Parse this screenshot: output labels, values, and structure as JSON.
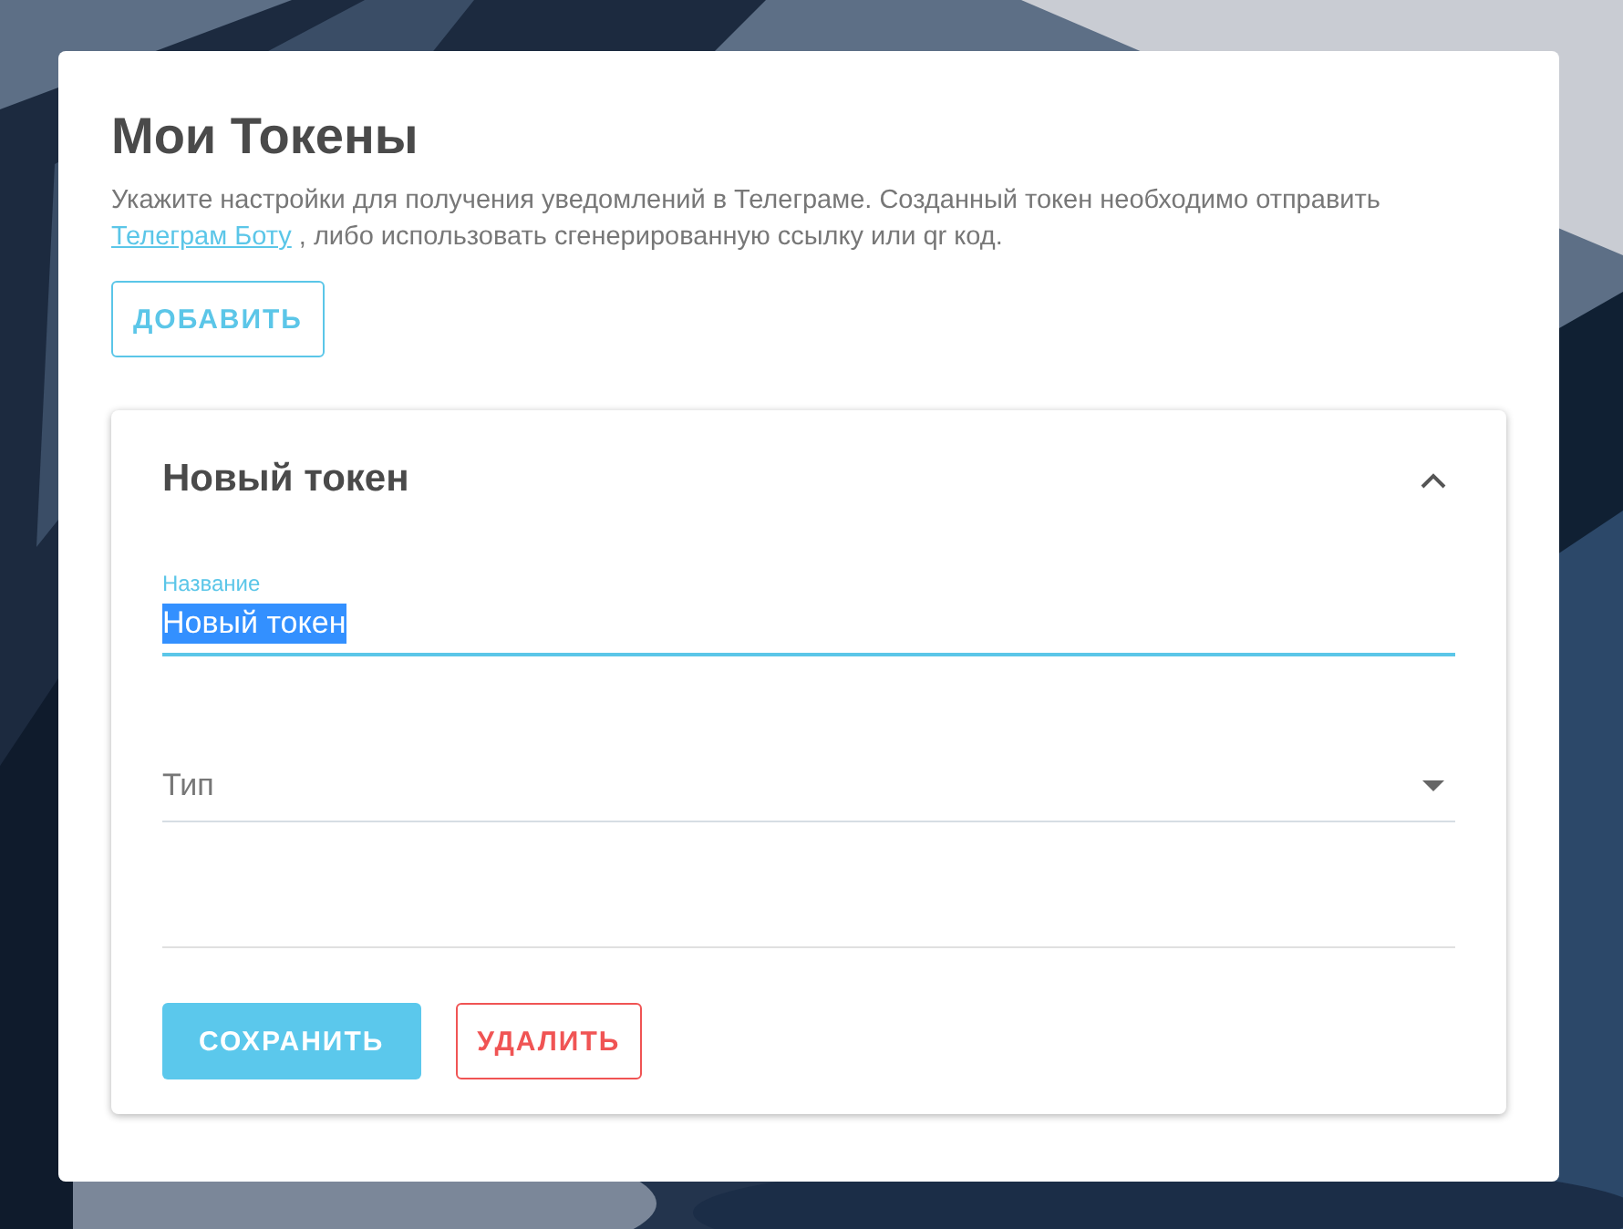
{
  "title": "Мои Токены",
  "description": {
    "before": "Укажите настройки для получения уведомлений в Телеграме. Созданный токен необходимо отправить ",
    "link": "Телеграм Боту",
    "after": " , либо использовать сгенерированную ссылку или qr код."
  },
  "add_button": "ДОБАВИТЬ",
  "tokens": [
    {
      "title": "Новый токен",
      "expanded": true,
      "fields": [
        {
          "kind": "text",
          "label": "Название",
          "value": "Новый токен",
          "focused": true,
          "text_selected": true
        },
        {
          "kind": "select",
          "placeholder": "Тип",
          "focused": false
        }
      ],
      "buttons": [
        {
          "kind": "primary",
          "label": "СОХРАНИТЬ"
        },
        {
          "kind": "danger",
          "label": "УДАЛИТЬ"
        }
      ]
    }
  ]
}
